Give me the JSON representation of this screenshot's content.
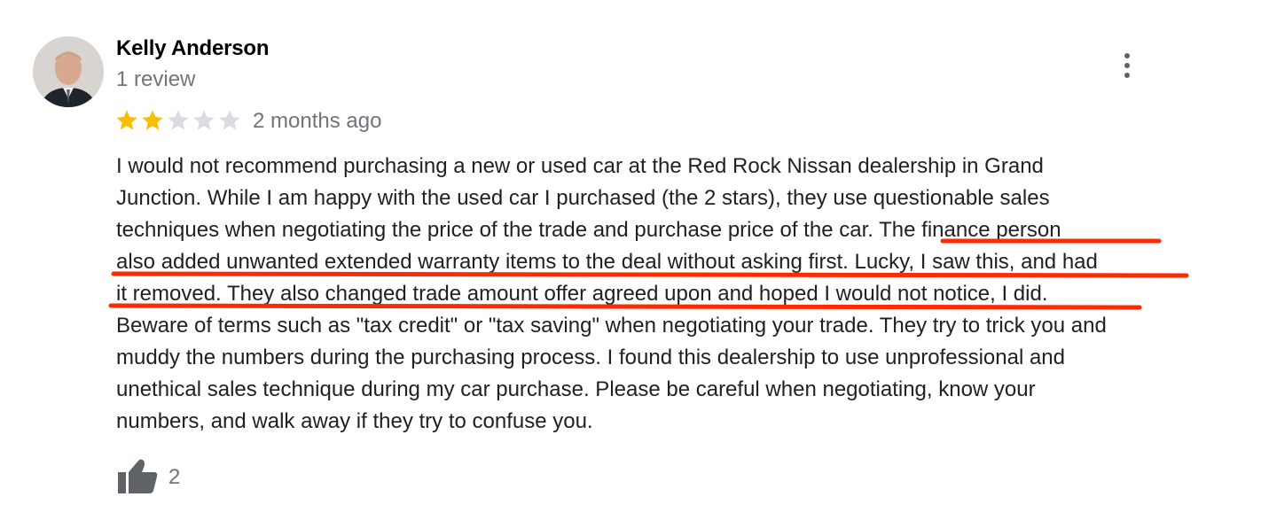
{
  "review": {
    "author_name": "Kelly Anderson",
    "review_count": "1 review",
    "rating": 2,
    "max_rating": 5,
    "time_ago": "2 months ago",
    "text_lines": [
      "I would not recommend purchasing a new or used car at the Red Rock Nissan dealership in Grand",
      "Junction. While I am happy with the used car I purchased (the 2 stars), they use questionable sales",
      "techniques when negotiating the price of the trade and purchase price of the car. The finance person",
      "also added unwanted extended warranty items to the deal without asking first. Lucky, I saw this, and had",
      "it removed. They also changed trade amount offer agreed upon and hoped I would not notice, I did.",
      "Beware of terms such as \"tax credit\" or \"tax saving\" when negotiating your trade. They try to trick you and",
      "muddy the numbers during the purchasing process. I found this dealership to use unprofessional and",
      "unethical sales technique during my car purchase. Please be careful when negotiating, know your",
      "numbers, and walk away if they try to confuse you."
    ],
    "like_count": "2"
  },
  "icons": {
    "avatar": "avatar",
    "more": "more-vert-icon",
    "star": "star-icon",
    "like": "thumbs-up-icon"
  },
  "colors": {
    "star_filled": "#fbbc04",
    "star_empty": "#dadce0",
    "underline_annotation": "#ff2a00",
    "secondary_text": "#70757a"
  }
}
